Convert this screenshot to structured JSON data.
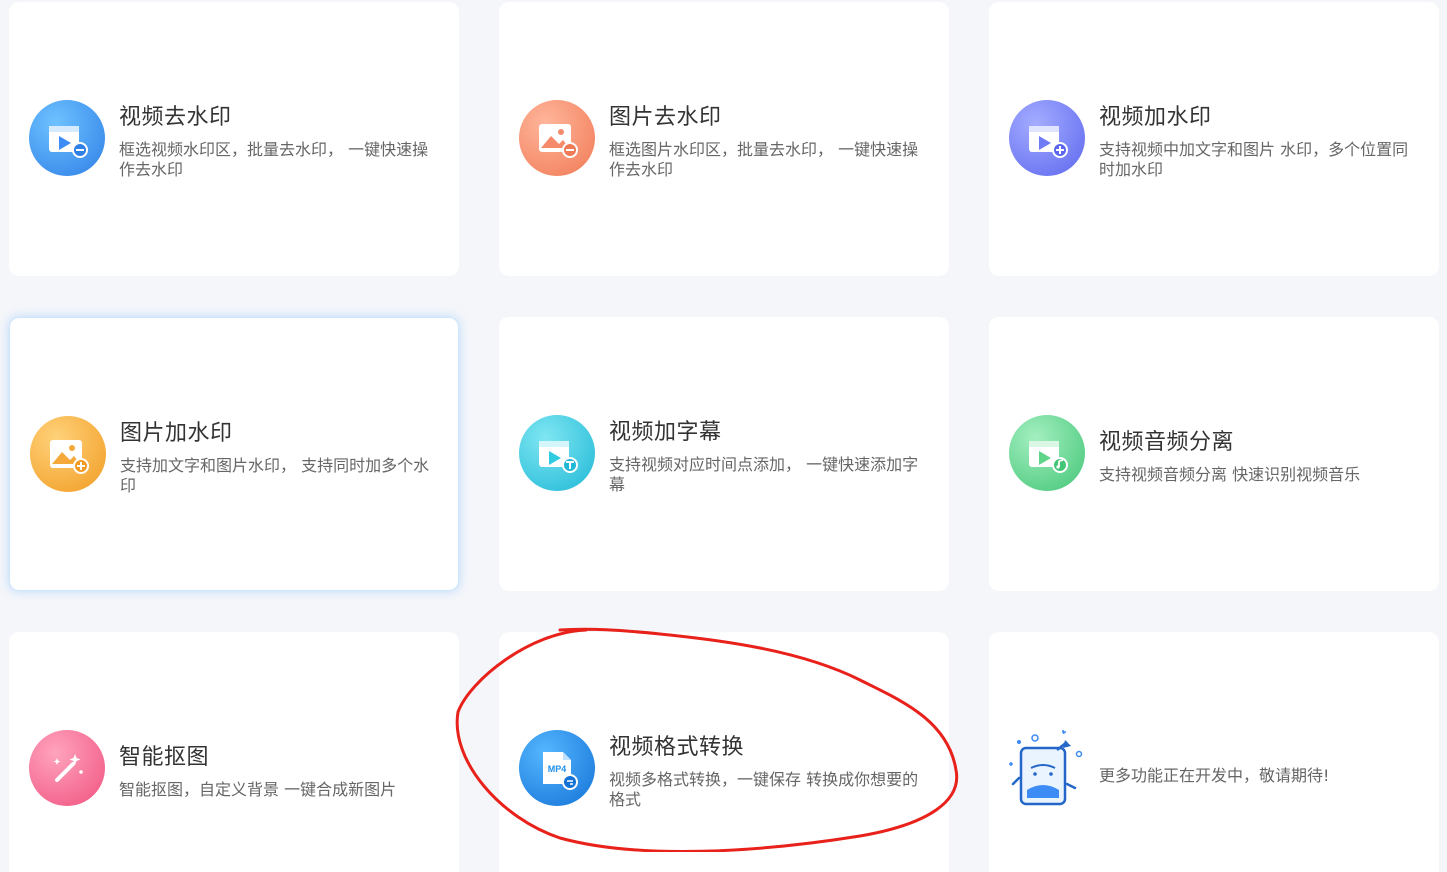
{
  "cards": [
    {
      "title": "视频去水印",
      "desc": "框选视频水印区，批量去水印， 一键快速操作去水印",
      "icon": "video-remove-watermark-icon",
      "color": "#3d8bf5"
    },
    {
      "title": "图片去水印",
      "desc": "框选图片水印区，批量去水印， 一键快速操作去水印",
      "icon": "image-remove-watermark-icon",
      "color": "#f58b6b"
    },
    {
      "title": "视频加水印",
      "desc": "支持视频中加文字和图片 水印，多个位置同时加水印",
      "icon": "video-add-watermark-icon",
      "color": "#6f7cf5"
    },
    {
      "title": "图片加水印",
      "desc": "支持加文字和图片水印， 支持同时加多个水印",
      "icon": "image-add-watermark-icon",
      "color": "#f5a93b"
    },
    {
      "title": "视频加字幕",
      "desc": "支持视频对应时间点添加， 一键快速添加字幕",
      "icon": "video-subtitle-icon",
      "color": "#2fcbe0"
    },
    {
      "title": "视频音频分离",
      "desc": "支持视频音频分离 快速识别视频音乐",
      "icon": "audio-separate-icon",
      "color": "#5fd58a"
    },
    {
      "title": "智能抠图",
      "desc": "智能抠图，自定义背景 一键合成新图片",
      "icon": "magic-wand-icon",
      "color": "#f56a8f"
    },
    {
      "title": "视频格式转换",
      "desc": "视频多格式转换，一键保存 转换成你想要的格式",
      "icon": "mp4-convert-icon",
      "color": "#1f8fea",
      "icon_text": "MP4"
    },
    {
      "title": "更多功能正在开发中，敬请期待!",
      "icon": "coming-soon-illustration-icon"
    }
  ]
}
